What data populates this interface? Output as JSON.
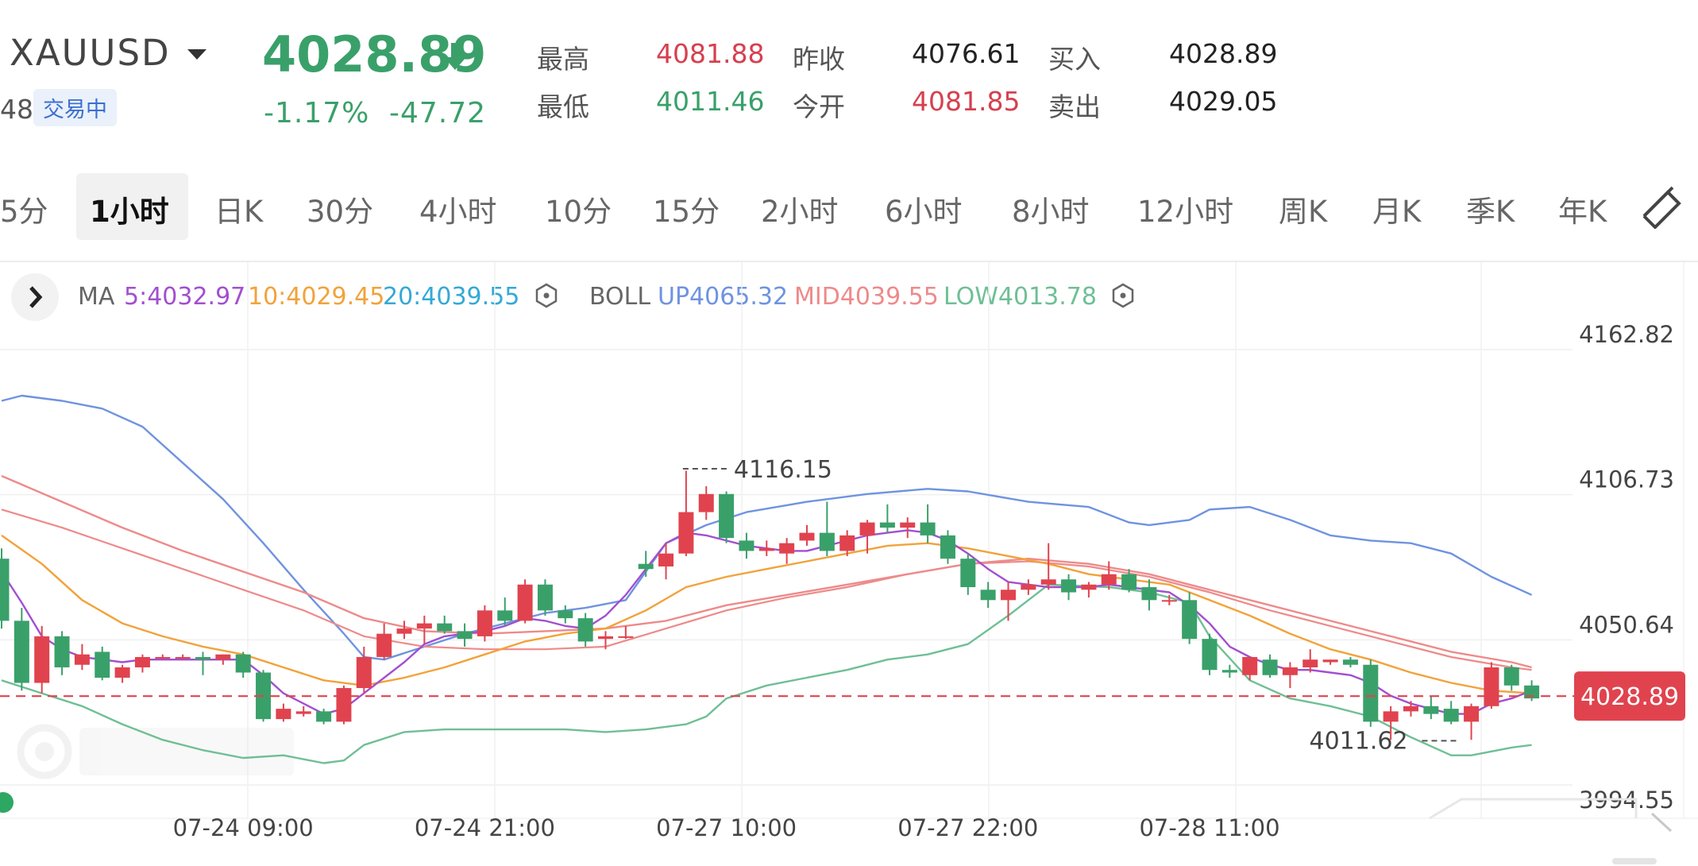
{
  "header": {
    "symbol": "XAUUSD",
    "volume_partial": "48",
    "status": "交易中",
    "price": "4028.89",
    "change_pct": "-1.17%",
    "change_abs": "-47.72",
    "quotes": [
      {
        "label": "最高",
        "value": "4081.88",
        "color": "#d6404f"
      },
      {
        "label": "最低",
        "value": "4011.46",
        "color": "#3aa06a"
      },
      {
        "label": "昨收",
        "value": "4076.61",
        "color": "#222222"
      },
      {
        "label": "今开",
        "value": "4081.85",
        "color": "#d6404f"
      },
      {
        "label": "买入",
        "value": "4028.89",
        "color": "#222222"
      },
      {
        "label": "卖出",
        "value": "4029.05",
        "color": "#222222"
      }
    ]
  },
  "timeframes": [
    "5分",
    "1小时",
    "日K",
    "30分",
    "4小时",
    "10分",
    "15分",
    "2小时",
    "6小时",
    "8小时",
    "12小时",
    "周K",
    "月K",
    "季K",
    "年K"
  ],
  "active_timeframe": "1小时",
  "indicators": {
    "ma_label": "MA",
    "ma5": "5:4032.97",
    "ma10": "10:4029.45",
    "ma20": "20:4039.55",
    "boll_label": "BOLL",
    "boll_up": "UP4065.32",
    "boll_mid": "MID4039.55",
    "boll_low": "LOW4013.78"
  },
  "colors": {
    "up": "#e0434e",
    "down": "#3aa06a",
    "ma5": "#a24fd0",
    "ma10": "#f2a23a",
    "ma20": "#34a9d6",
    "boll_up": "#6f93e0",
    "boll_mid": "#ee8a8a",
    "boll_low": "#6fbf95"
  },
  "chart_data": {
    "type": "candlestick",
    "y_axis_labels": [
      "4162.82",
      "4106.73",
      "4050.64",
      "3994.55"
    ],
    "ylim": [
      3994.55,
      4162.82
    ],
    "x_axis_labels": [
      {
        "label": "07-24 09:00",
        "index": 12
      },
      {
        "label": "07-24 21:00",
        "index": 24
      },
      {
        "label": "07-27 10:00",
        "index": 36
      },
      {
        "label": "07-27 22:00",
        "index": 48
      },
      {
        "label": "07-28 11:00",
        "index": 60
      }
    ],
    "current_price": "4028.89",
    "annotations": [
      {
        "text": "4116.15",
        "index": 34,
        "value": 4116.15,
        "kind": "high"
      },
      {
        "text": "4011.62",
        "index": 70,
        "value": 4011.62,
        "kind": "low"
      }
    ],
    "candles": [
      {
        "o": 4082,
        "h": 4086,
        "c": 4058,
        "l": 4055
      },
      {
        "o": 4058,
        "h": 4063,
        "c": 4034,
        "l": 4031
      },
      {
        "o": 4034,
        "h": 4056,
        "c": 4052,
        "l": 4030
      },
      {
        "o": 4052,
        "h": 4054,
        "c": 4040,
        "l": 4037
      },
      {
        "o": 4041,
        "h": 4049,
        "c": 4045,
        "l": 4039
      },
      {
        "o": 4046,
        "h": 4048,
        "c": 4036,
        "l": 4035
      },
      {
        "o": 4036,
        "h": 4041,
        "c": 4040,
        "l": 4034
      },
      {
        "o": 4040,
        "h": 4045,
        "c": 4044,
        "l": 4038
      },
      {
        "o": 4044,
        "h": 4045,
        "c": 4044,
        "l": 4043
      },
      {
        "o": 4044,
        "h": 4045,
        "c": 4044,
        "l": 4043
      },
      {
        "o": 4044,
        "h": 4046,
        "c": 4043,
        "l": 4037
      },
      {
        "o": 4043,
        "h": 4045,
        "c": 4045,
        "l": 4041
      },
      {
        "o": 4045,
        "h": 4046,
        "c": 4038,
        "l": 4036
      },
      {
        "o": 4038,
        "h": 4039,
        "c": 4020,
        "l": 4019
      },
      {
        "o": 4020,
        "h": 4026,
        "c": 4024,
        "l": 4019
      },
      {
        "o": 4022,
        "h": 4025,
        "c": 4023,
        "l": 4021
      },
      {
        "o": 4023,
        "h": 4024,
        "c": 4019,
        "l": 4018
      },
      {
        "o": 4019,
        "h": 4033,
        "c": 4032,
        "l": 4018
      },
      {
        "o": 4032,
        "h": 4048,
        "c": 4044,
        "l": 4030
      },
      {
        "o": 4044,
        "h": 4057,
        "c": 4053,
        "l": 4043
      },
      {
        "o": 4053,
        "h": 4058,
        "c": 4055,
        "l": 4051
      },
      {
        "o": 4055,
        "h": 4060,
        "c": 4057,
        "l": 4049
      },
      {
        "o": 4057,
        "h": 4060,
        "c": 4054,
        "l": 4053
      },
      {
        "o": 4054,
        "h": 4057,
        "c": 4051,
        "l": 4048
      },
      {
        "o": 4052,
        "h": 4064,
        "c": 4062,
        "l": 4050
      },
      {
        "o": 4062,
        "h": 4067,
        "c": 4058,
        "l": 4056
      },
      {
        "o": 4058,
        "h": 4074,
        "c": 4072,
        "l": 4057
      },
      {
        "o": 4072,
        "h": 4074,
        "c": 4062,
        "l": 4060
      },
      {
        "o": 4062,
        "h": 4064,
        "c": 4059,
        "l": 4057
      },
      {
        "o": 4059,
        "h": 4061,
        "c": 4050,
        "l": 4048
      },
      {
        "o": 4051,
        "h": 4054,
        "c": 4052,
        "l": 4047
      },
      {
        "o": 4052,
        "h": 4056,
        "c": 4052,
        "l": 4051
      },
      {
        "o": 4080,
        "h": 4085,
        "c": 4078,
        "l": 4075
      },
      {
        "o": 4079,
        "h": 4088,
        "c": 4084,
        "l": 4074
      },
      {
        "o": 4084,
        "h": 4116,
        "c": 4100,
        "l": 4083
      },
      {
        "o": 4100,
        "h": 4110,
        "c": 4107,
        "l": 4097
      },
      {
        "o": 4107,
        "h": 4108,
        "c": 4090,
        "l": 4088
      },
      {
        "o": 4089,
        "h": 4092,
        "c": 4085,
        "l": 4082
      },
      {
        "o": 4085,
        "h": 4089,
        "c": 4086,
        "l": 4083
      },
      {
        "o": 4084,
        "h": 4090,
        "c": 4088,
        "l": 4080
      },
      {
        "o": 4089,
        "h": 4095,
        "c": 4092,
        "l": 4087
      },
      {
        "o": 4092,
        "h": 4104,
        "c": 4085,
        "l": 4083
      },
      {
        "o": 4085,
        "h": 4093,
        "c": 4091,
        "l": 4083
      },
      {
        "o": 4091,
        "h": 4097,
        "c": 4096,
        "l": 4084
      },
      {
        "o": 4096,
        "h": 4103,
        "c": 4094,
        "l": 4092
      },
      {
        "o": 4094,
        "h": 4098,
        "c": 4096,
        "l": 4090
      },
      {
        "o": 4096,
        "h": 4103,
        "c": 4091,
        "l": 4088
      },
      {
        "o": 4091,
        "h": 4093,
        "c": 4082,
        "l": 4080
      },
      {
        "o": 4082,
        "h": 4084,
        "c": 4071,
        "l": 4068
      },
      {
        "o": 4070,
        "h": 4073,
        "c": 4066,
        "l": 4063
      },
      {
        "o": 4066,
        "h": 4073,
        "c": 4070,
        "l": 4058
      },
      {
        "o": 4070,
        "h": 4074,
        "c": 4072,
        "l": 4068
      },
      {
        "o": 4072,
        "h": 4088,
        "c": 4074,
        "l": 4070
      },
      {
        "o": 4074,
        "h": 4076,
        "c": 4069,
        "l": 4066
      },
      {
        "o": 4070,
        "h": 4073,
        "c": 4072,
        "l": 4067
      },
      {
        "o": 4072,
        "h": 4081,
        "c": 4076,
        "l": 4070
      },
      {
        "o": 4076,
        "h": 4078,
        "c": 4070,
        "l": 4069
      },
      {
        "o": 4071,
        "h": 4074,
        "c": 4066,
        "l": 4062
      },
      {
        "o": 4066,
        "h": 4068,
        "c": 4066,
        "l": 4064
      },
      {
        "o": 4066,
        "h": 4069,
        "c": 4051,
        "l": 4049
      },
      {
        "o": 4051,
        "h": 4053,
        "c": 4039,
        "l": 4037
      },
      {
        "o": 4039,
        "h": 4041,
        "c": 4038,
        "l": 4036
      },
      {
        "o": 4037,
        "h": 4044,
        "c": 4044,
        "l": 4035
      },
      {
        "o": 4043,
        "h": 4045,
        "c": 4037,
        "l": 4036
      },
      {
        "o": 4037,
        "h": 4042,
        "c": 4040,
        "l": 4032
      },
      {
        "o": 4040,
        "h": 4047,
        "c": 4043,
        "l": 4038
      },
      {
        "o": 4042,
        "h": 4043,
        "c": 4043,
        "l": 4041
      },
      {
        "o": 4043,
        "h": 4044,
        "c": 4041,
        "l": 4040
      },
      {
        "o": 4041,
        "h": 4043,
        "c": 4019,
        "l": 4017
      },
      {
        "o": 4019,
        "h": 4025,
        "c": 4023,
        "l": 4012
      },
      {
        "o": 4023,
        "h": 4027,
        "c": 4025,
        "l": 4021
      },
      {
        "o": 4025,
        "h": 4029,
        "c": 4022,
        "l": 4020
      },
      {
        "o": 4024,
        "h": 4027,
        "c": 4019,
        "l": 4018
      },
      {
        "o": 4019,
        "h": 4026,
        "c": 4025,
        "l": 4012
      },
      {
        "o": 4025,
        "h": 4042,
        "c": 4040,
        "l": 4024
      },
      {
        "o": 4040,
        "h": 4041,
        "c": 4033,
        "l": 4031
      },
      {
        "o": 4033,
        "h": 4035,
        "c": 4028,
        "l": 4027
      }
    ],
    "ma5": [
      [
        0,
        4077
      ],
      [
        1,
        4065
      ],
      [
        2,
        4052
      ],
      [
        3,
        4047
      ],
      [
        4,
        4044
      ],
      [
        5,
        4043
      ],
      [
        6,
        4042
      ],
      [
        7,
        4043
      ],
      [
        8,
        4043
      ],
      [
        10,
        4043
      ],
      [
        12,
        4043
      ],
      [
        13,
        4037
      ],
      [
        14,
        4030
      ],
      [
        15,
        4026
      ],
      [
        16,
        4022
      ],
      [
        17,
        4024
      ],
      [
        18,
        4030
      ],
      [
        19,
        4036
      ],
      [
        20,
        4042
      ],
      [
        21,
        4049
      ],
      [
        22,
        4052
      ],
      [
        23,
        4053
      ],
      [
        24,
        4054
      ],
      [
        25,
        4056
      ],
      [
        26,
        4059
      ],
      [
        27,
        4058
      ],
      [
        28,
        4056
      ],
      [
        29,
        4055
      ],
      [
        30,
        4060
      ],
      [
        31,
        4068
      ],
      [
        32,
        4078
      ],
      [
        33,
        4088
      ],
      [
        34,
        4092
      ],
      [
        35,
        4091
      ],
      [
        36,
        4089
      ],
      [
        37,
        4087
      ],
      [
        38,
        4086
      ],
      [
        39,
        4085
      ],
      [
        40,
        4085
      ],
      [
        41,
        4087
      ],
      [
        42,
        4089
      ],
      [
        43,
        4091
      ],
      [
        44,
        4092
      ],
      [
        45,
        4093
      ],
      [
        46,
        4092
      ],
      [
        47,
        4089
      ],
      [
        48,
        4084
      ],
      [
        49,
        4078
      ],
      [
        50,
        4073
      ],
      [
        51,
        4072
      ],
      [
        52,
        4071
      ],
      [
        53,
        4071
      ],
      [
        54,
        4071
      ],
      [
        55,
        4072
      ],
      [
        56,
        4071
      ],
      [
        57,
        4070
      ],
      [
        58,
        4069
      ],
      [
        59,
        4064
      ],
      [
        60,
        4057
      ],
      [
        61,
        4048
      ],
      [
        62,
        4044
      ],
      [
        63,
        4041
      ],
      [
        64,
        4039
      ],
      [
        65,
        4039
      ],
      [
        66,
        4038
      ],
      [
        67,
        4037
      ],
      [
        68,
        4034
      ],
      [
        69,
        4029
      ],
      [
        70,
        4026
      ],
      [
        71,
        4024
      ],
      [
        72,
        4022
      ],
      [
        73,
        4022
      ],
      [
        74,
        4026
      ],
      [
        75,
        4028
      ],
      [
        76,
        4031
      ]
    ],
    "ma10": [
      [
        0,
        4091
      ],
      [
        2,
        4080
      ],
      [
        4,
        4066
      ],
      [
        6,
        4057
      ],
      [
        8,
        4052
      ],
      [
        10,
        4048
      ],
      [
        12,
        4045
      ],
      [
        14,
        4040
      ],
      [
        16,
        4035
      ],
      [
        18,
        4033
      ],
      [
        20,
        4036
      ],
      [
        22,
        4040
      ],
      [
        24,
        4045
      ],
      [
        26,
        4050
      ],
      [
        28,
        4053
      ],
      [
        30,
        4055
      ],
      [
        32,
        4062
      ],
      [
        34,
        4071
      ],
      [
        36,
        4075
      ],
      [
        38,
        4078
      ],
      [
        40,
        4081
      ],
      [
        42,
        4084
      ],
      [
        44,
        4087
      ],
      [
        46,
        4088
      ],
      [
        48,
        4086
      ],
      [
        50,
        4083
      ],
      [
        52,
        4080
      ],
      [
        54,
        4076
      ],
      [
        56,
        4074
      ],
      [
        58,
        4072
      ],
      [
        60,
        4066
      ],
      [
        62,
        4060
      ],
      [
        64,
        4053
      ],
      [
        66,
        4047
      ],
      [
        68,
        4043
      ],
      [
        70,
        4038
      ],
      [
        72,
        4034
      ],
      [
        74,
        4031
      ],
      [
        76,
        4030
      ]
    ],
    "ma20": [
      [
        0,
        4101
      ],
      [
        3,
        4094
      ],
      [
        6,
        4086
      ],
      [
        9,
        4078
      ],
      [
        12,
        4070
      ],
      [
        15,
        4062
      ],
      [
        18,
        4052
      ],
      [
        21,
        4048
      ],
      [
        24,
        4047
      ],
      [
        27,
        4047
      ],
      [
        30,
        4048
      ],
      [
        33,
        4055
      ],
      [
        36,
        4062
      ],
      [
        39,
        4067
      ],
      [
        42,
        4071
      ],
      [
        45,
        4076
      ],
      [
        48,
        4080
      ],
      [
        51,
        4081
      ],
      [
        54,
        4079
      ],
      [
        57,
        4075
      ],
      [
        60,
        4069
      ],
      [
        63,
        4062
      ],
      [
        66,
        4056
      ],
      [
        69,
        4050
      ],
      [
        72,
        4044
      ],
      [
        75,
        4040
      ],
      [
        76,
        4039
      ]
    ],
    "boll_up": [
      [
        0,
        4143
      ],
      [
        1,
        4145
      ],
      [
        3,
        4143
      ],
      [
        5,
        4140
      ],
      [
        7,
        4133
      ],
      [
        9,
        4119
      ],
      [
        11,
        4105
      ],
      [
        13,
        4088
      ],
      [
        15,
        4070
      ],
      [
        17,
        4053
      ],
      [
        18,
        4044
      ],
      [
        19,
        4043
      ],
      [
        21,
        4048
      ],
      [
        23,
        4053
      ],
      [
        25,
        4057
      ],
      [
        27,
        4061
      ],
      [
        29,
        4063
      ],
      [
        31,
        4066
      ],
      [
        32,
        4077
      ],
      [
        33,
        4088
      ],
      [
        35,
        4095
      ],
      [
        37,
        4100
      ],
      [
        40,
        4104
      ],
      [
        43,
        4107
      ],
      [
        46,
        4109
      ],
      [
        48,
        4108
      ],
      [
        51,
        4104
      ],
      [
        54,
        4102
      ],
      [
        56,
        4096
      ],
      [
        57,
        4095
      ],
      [
        59,
        4097
      ],
      [
        60,
        4101
      ],
      [
        62,
        4102
      ],
      [
        64,
        4097
      ],
      [
        66,
        4091
      ],
      [
        68,
        4089
      ],
      [
        70,
        4088
      ],
      [
        72,
        4084
      ],
      [
        74,
        4075
      ],
      [
        76,
        4068
      ]
    ],
    "boll_low": [
      [
        0,
        4035
      ],
      [
        2,
        4030
      ],
      [
        4,
        4025
      ],
      [
        6,
        4018
      ],
      [
        8,
        4012
      ],
      [
        10,
        4008
      ],
      [
        12,
        4005
      ],
      [
        14,
        4006
      ],
      [
        16,
        4003
      ],
      [
        17,
        4004
      ],
      [
        18,
        4010
      ],
      [
        20,
        4015
      ],
      [
        22,
        4016
      ],
      [
        24,
        4016
      ],
      [
        26,
        4016
      ],
      [
        28,
        4016
      ],
      [
        30,
        4015
      ],
      [
        32,
        4016
      ],
      [
        34,
        4018
      ],
      [
        35,
        4021
      ],
      [
        36,
        4028
      ],
      [
        38,
        4033
      ],
      [
        40,
        4036
      ],
      [
        42,
        4039
      ],
      [
        44,
        4043
      ],
      [
        46,
        4045
      ],
      [
        48,
        4049
      ],
      [
        50,
        4060
      ],
      [
        52,
        4072
      ],
      [
        55,
        4071
      ],
      [
        57,
        4069
      ],
      [
        59,
        4065
      ],
      [
        60,
        4052
      ],
      [
        62,
        4035
      ],
      [
        64,
        4028
      ],
      [
        66,
        4025
      ],
      [
        68,
        4021
      ],
      [
        70,
        4013
      ],
      [
        72,
        4006
      ],
      [
        73,
        4006
      ],
      [
        75,
        4009
      ],
      [
        76,
        4010
      ]
    ],
    "boll_mid": [
      [
        0,
        4114
      ],
      [
        3,
        4104
      ],
      [
        6,
        4094
      ],
      [
        9,
        4085
      ],
      [
        12,
        4077
      ],
      [
        15,
        4069
      ],
      [
        18,
        4059
      ],
      [
        21,
        4054
      ],
      [
        24,
        4053
      ],
      [
        27,
        4054
      ],
      [
        30,
        4055
      ],
      [
        33,
        4058
      ],
      [
        36,
        4064
      ],
      [
        39,
        4068
      ],
      [
        42,
        4072
      ],
      [
        45,
        4076
      ],
      [
        48,
        4080
      ],
      [
        51,
        4082
      ],
      [
        54,
        4080
      ],
      [
        57,
        4076
      ],
      [
        60,
        4070
      ],
      [
        63,
        4064
      ],
      [
        66,
        4058
      ],
      [
        69,
        4052
      ],
      [
        72,
        4046
      ],
      [
        75,
        4042
      ],
      [
        76,
        4040
      ]
    ]
  }
}
